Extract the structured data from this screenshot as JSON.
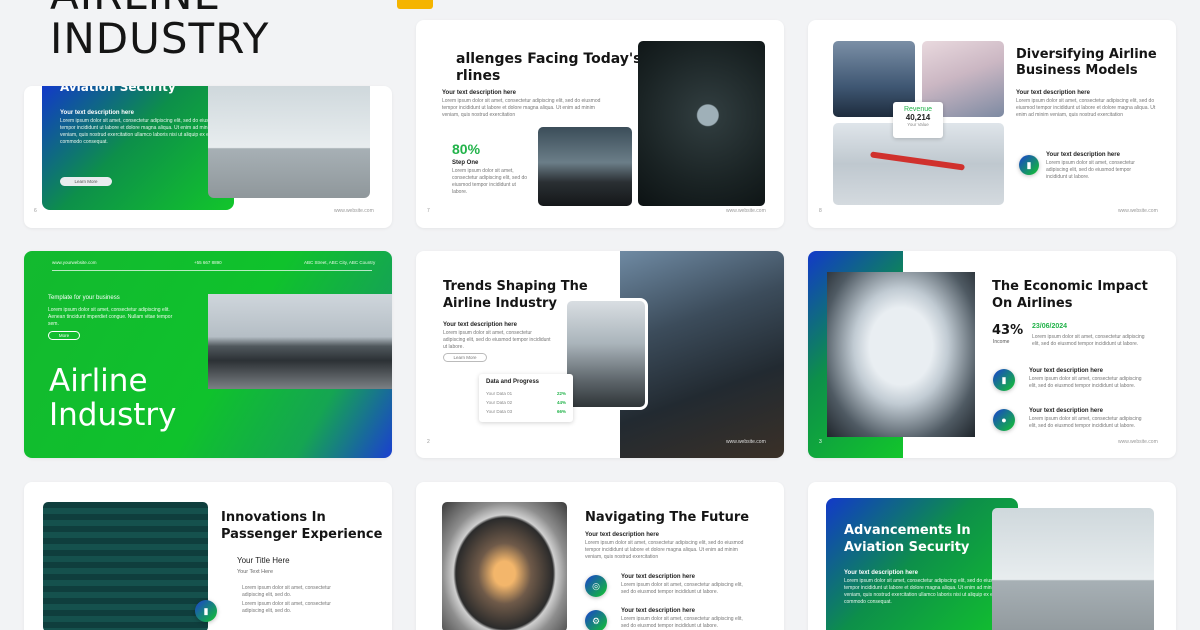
{
  "header": {
    "title_top": "AIRLINE",
    "title": "INDUSTRY"
  },
  "lorem": {
    "long": "Lorem ipsum dolor sit amet, consectetur adipiscing elit, sed do eiusmod tempor incididunt ut labore et dolore magna aliqua. Ut enim ad minim veniam, quis nostrud exercitation",
    "short": "Lorem ipsum dolor sit amet, consectetur adipiscing elit, sed do eiusmod tempor incididunt ut labore.",
    "sec": "Lorem ipsum dolor sit amet, consectetur adipiscing elit, sed do eiusmod tempor incididunt ut labore et dolore magna aliqua. Ut enim ad minim veniam, quis nostrud exercitation ullamco laboris nisi ut aliquip ex ea commodo consequat."
  },
  "website": "www.website.com",
  "desc_heading": "Your text description here",
  "slides": {
    "s6": {
      "title": "Aviation Security",
      "button": "Learn More",
      "page": "6"
    },
    "s7": {
      "title_1": "allenges Facing Today's",
      "title_2": "rlines",
      "stat": "80%",
      "stat_label": "Step One",
      "page": "7"
    },
    "s8": {
      "title_1": "Diversifying Airline",
      "title_2": "Business Models",
      "rev_label": "Revenue",
      "rev_value": "40,214",
      "rev_sub": "Your Value",
      "page": "8"
    },
    "cover": {
      "website": "www.yourwebsite.com",
      "phone": "+55 667 8890",
      "address": "ABC Street, ABC City, ABC Country",
      "template": "Template for your business",
      "text": "Lorem ipsum dolor sit amet, consectetur adipiscing elit. Aenean tincidunt imperdiet congue. Nullam vitae tempor sem.",
      "button": "More",
      "title_1": "Airline",
      "title_2": "Industry"
    },
    "s2": {
      "title_1": "Trends Shaping The",
      "title_2": "Airline Industry",
      "button": "Learn More",
      "progress_title": "Data and Progress",
      "rows": [
        {
          "label": "Your Data 01",
          "value": "22%"
        },
        {
          "label": "Your Data 02",
          "value": "44%"
        },
        {
          "label": "Your Data 03",
          "value": "66%"
        }
      ],
      "page": "2"
    },
    "s3": {
      "title_1": "The Economic Impact",
      "title_2": "On Airlines",
      "stat": "43%",
      "stat_label": "Income",
      "date": "23/06/2024",
      "page": "3"
    },
    "s9": {
      "title_1": "Innovations In",
      "title_2": "Passenger Experience",
      "your_title": "Your Title Here",
      "your_text": "Your Text Here",
      "b1": "Lorem ipsum dolor sit amet, consectetur adipiscing elit, sed do.",
      "b2": "Lorem ipsum dolor sit amet, consectetur adipiscing elit, sed do."
    },
    "s10": {
      "title": "Navigating The Future"
    },
    "s11": {
      "title_1": "Advancements In",
      "title_2": "Aviation Security"
    }
  }
}
